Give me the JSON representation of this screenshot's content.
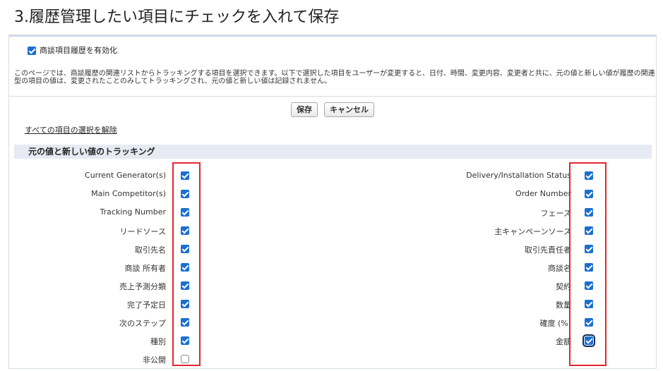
{
  "heading": "3.履歴管理したい項目にチェックを入れて保存",
  "enable_history": {
    "label": "商談項目履歴を有効化",
    "checked": true
  },
  "description": {
    "line1": "このページでは、商談履歴の関連リストからトラッキングする項目を選択できます。以下で選択した項目をユーザーが変更すると、日付、時間、変更内容、変更者と共に、元の値と新しい値が履歴の関連リ",
    "line2": "型の項目の値は、変更されたことのみしてトラッキングされ、元の値と新しい値は記録されません。"
  },
  "buttons": {
    "save": "保存",
    "cancel": "キャンセル"
  },
  "deselect_all": "すべての項目の選択を解除",
  "section_title": "元の値と新しい値のトラッキング",
  "left_fields": [
    {
      "label": "Current Generator(s)",
      "checked": true
    },
    {
      "label": "Main Competitor(s)",
      "checked": true
    },
    {
      "label": "Tracking Number",
      "checked": true
    },
    {
      "label": "リードソース",
      "checked": true
    },
    {
      "label": "取引先名",
      "checked": true
    },
    {
      "label": "商談 所有者",
      "checked": true
    },
    {
      "label": "売上予測分類",
      "checked": true
    },
    {
      "label": "完了予定日",
      "checked": true
    },
    {
      "label": "次のステップ",
      "checked": true
    },
    {
      "label": "種別",
      "checked": true
    },
    {
      "label": "非公開",
      "checked": false
    }
  ],
  "right_fields": [
    {
      "label": "Delivery/Installation Status",
      "checked": true
    },
    {
      "label": "Order Number",
      "checked": true
    },
    {
      "label": "フェーズ",
      "checked": true
    },
    {
      "label": "主キャンペーンソース",
      "checked": true
    },
    {
      "label": "取引先責任者",
      "checked": true
    },
    {
      "label": "商談名",
      "checked": true
    },
    {
      "label": "契約",
      "checked": true
    },
    {
      "label": "数量",
      "checked": true
    },
    {
      "label": "確度 (%)",
      "checked": true
    },
    {
      "label": "金額",
      "checked": true,
      "focused": true
    }
  ],
  "colors": {
    "accent": "#1b6fd1",
    "highlight": "#e4262d",
    "section_bg": "#e6ebf3"
  }
}
